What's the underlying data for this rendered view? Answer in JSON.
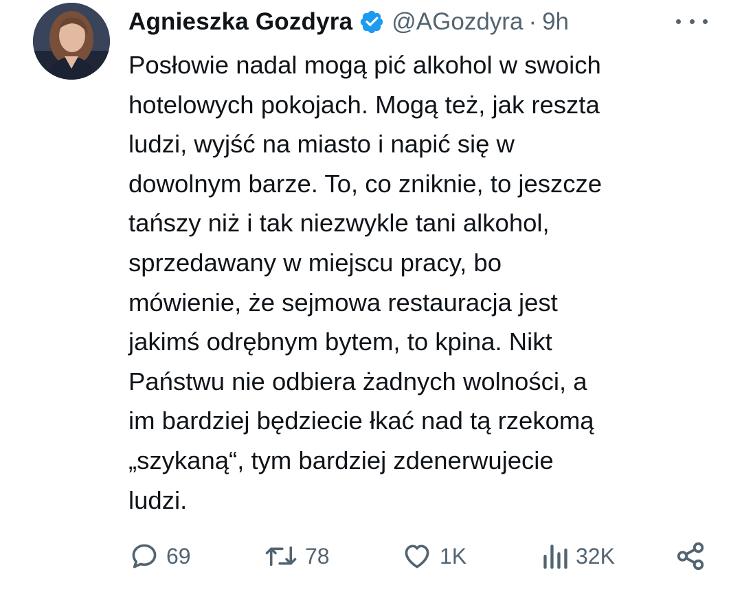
{
  "tweet": {
    "author": {
      "display_name": "Agnieszka Gozdyra",
      "handle": "@AGozdyra",
      "verified": true,
      "verified_color": "#1d9bf0"
    },
    "separator": "·",
    "timestamp": "9h",
    "text_lines": [
      "Posłowie nadal mogą pić alkohol w swoich",
      "hotelowych pokojach. Mogą też, jak reszta",
      "ludzi, wyjść na miasto i napić się w",
      "dowolnym barze. To, co zniknie, to jeszcze",
      "tańszy niż i tak niezwykle tani alkohol,",
      "sprzedawany w miejscu pracy, bo",
      "mówienie, że sejmowa restauracja jest",
      "jakimś odrębnym bytem, to kpina. Nikt",
      "Państwu nie odbiera żadnych wolności, a",
      "im bardziej będziecie łkać nad tą rzekomą",
      "„szykaną“, tym bardziej zdenerwujecie",
      "ludzi."
    ],
    "actions": {
      "replies": "69",
      "reposts": "78",
      "likes": "1K",
      "views": "32K"
    }
  },
  "icons": {
    "avatar": "avatar-photo",
    "verified": "verified-badge-icon",
    "more": "more-dots-icon",
    "reply": "reply-icon",
    "repost": "repost-icon",
    "like": "heart-icon",
    "views": "views-icon",
    "share": "share-icon"
  },
  "colors": {
    "text_primary": "#0f1419",
    "text_secondary": "#536471",
    "accent": "#1d9bf0"
  }
}
